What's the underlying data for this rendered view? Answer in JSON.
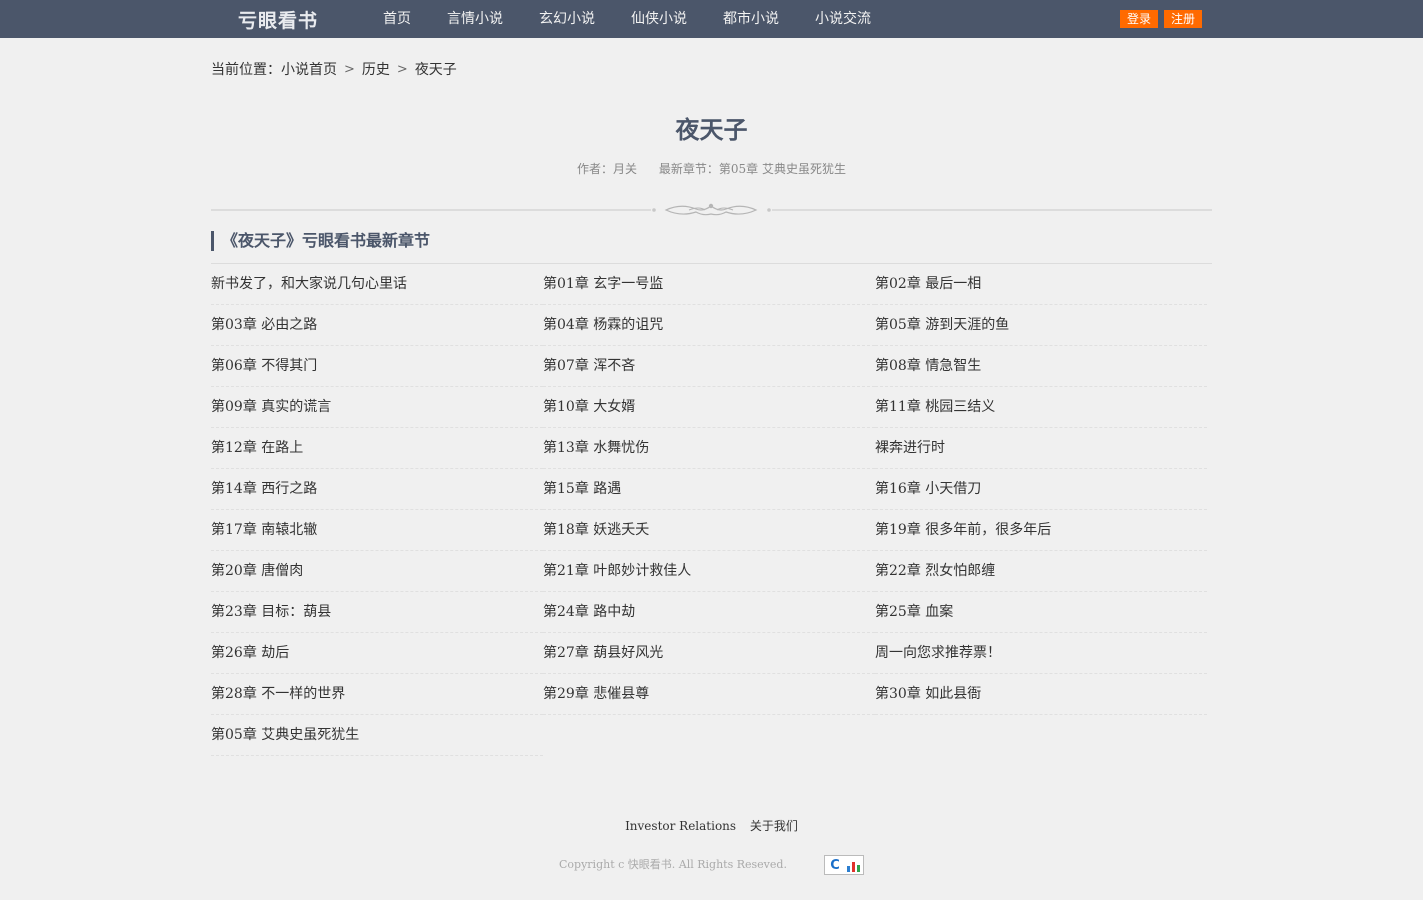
{
  "header": {
    "logo": "亏眼看书",
    "nav": [
      "首页",
      "言情小说",
      "玄幻小说",
      "仙侠小说",
      "都市小说",
      "小说交流"
    ],
    "login": "登录",
    "register": "注册"
  },
  "breadcrumb": {
    "prefix": "当前位置：",
    "items": [
      "小说首页",
      "历史",
      "夜天子"
    ]
  },
  "book": {
    "title": "夜天子",
    "author": "作者：月关",
    "latest": "最新章节：第05章 艾典史虽死犹生"
  },
  "section_title": "《夜天子》亏眼看书最新章节",
  "chapters": [
    "新书发了，和大家说几句心里话",
    "第01章 玄字一号监",
    "第02章 最后一相",
    "第03章 必由之路",
    "第04章 杨霖的诅咒",
    "第05章 游到天涯的鱼",
    "第06章 不得其门",
    "第07章 浑不吝",
    "第08章 情急智生",
    "第09章 真实的谎言",
    "第10章 大女婿",
    "第11章 桃园三结义",
    "第12章 在路上",
    "第13章 水舞忧伤",
    "裸奔进行时",
    "第14章 西行之路",
    "第15章 路遇",
    "第16章 小天借刀",
    "第17章 南辕北辙",
    "第18章 妖逃夭夭",
    "第19章 很多年前，很多年后",
    "第20章 唐僧肉",
    "第21章 叶郎妙计救佳人",
    "第22章 烈女怕郎缠",
    "第23章 目标：葫县",
    "第24章 路中劫",
    "第25章 血案",
    "第26章 劫后",
    "第27章 葫县好风光",
    "周一向您求推荐票！",
    "第28章 不一样的世界",
    "第29章 悲催县尊",
    "第30章 如此县衙",
    "第05章 艾典史虽死犹生"
  ],
  "footer": {
    "links": [
      "Investor Relations",
      "关于我们"
    ],
    "copyright": "Copyright c 快眼看书. All Rights Reseved."
  },
  "colors": {
    "header_bg": "#4b566a",
    "accent": "#ff6a00"
  }
}
